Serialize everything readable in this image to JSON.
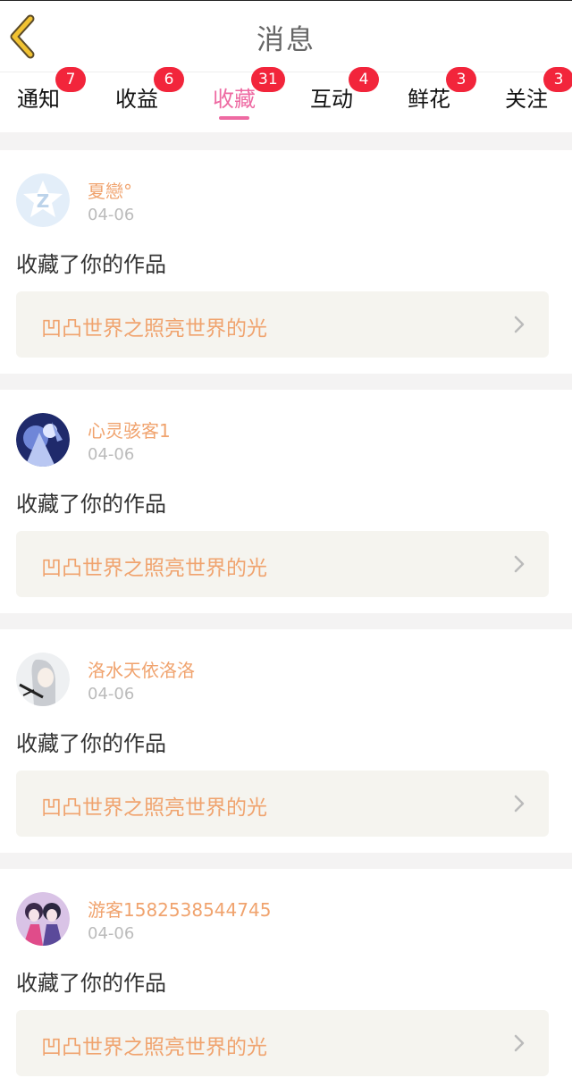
{
  "header": {
    "title": "消息"
  },
  "tabs": [
    {
      "label": "通知",
      "badge": "7"
    },
    {
      "label": "收益",
      "badge": "6"
    },
    {
      "label": "收藏",
      "badge": "31",
      "active": true
    },
    {
      "label": "互动",
      "badge": "4"
    },
    {
      "label": "鲜花",
      "badge": "3"
    },
    {
      "label": "关注",
      "badge": "3"
    }
  ],
  "colors": {
    "accent_pink": "#ee6aa2",
    "badge_red": "#f2253b",
    "name_orange": "#f0a36e",
    "link_bg": "#f5f4ef"
  },
  "items": [
    {
      "username": "夏戀°",
      "date": "04-06",
      "action": "收藏了你的作品",
      "work": "凹凸世界之照亮世界的光",
      "avatar_icon": "qq-logo-avatar"
    },
    {
      "username": "心灵骇客1",
      "date": "04-06",
      "action": "收藏了你的作品",
      "work": "凹凸世界之照亮世界的光",
      "avatar_icon": "anime-avatar-blue"
    },
    {
      "username": "洛水天依洛洛",
      "date": "04-06",
      "action": "收藏了你的作品",
      "work": "凹凸世界之照亮世界的光",
      "avatar_icon": "anime-avatar-gray"
    },
    {
      "username": "游客1582538544745",
      "date": "04-06",
      "action": "收藏了你的作品",
      "work": "凹凸世界之照亮世界的光",
      "avatar_icon": "anime-avatar-purple"
    }
  ]
}
